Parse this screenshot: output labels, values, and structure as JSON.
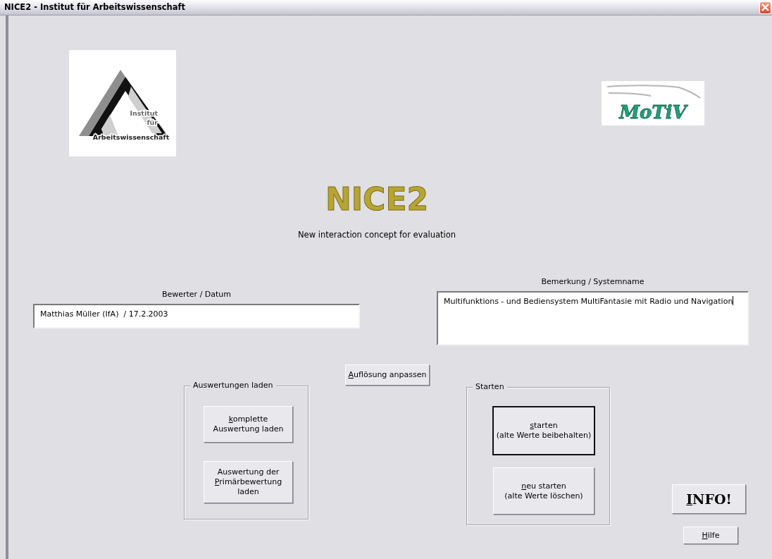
{
  "window": {
    "title": "NICE2 - Institut für Arbeitswissenschaft"
  },
  "logos": [
    {
      "kind": "institute",
      "lines": [
        "Institut",
        "für",
        "Arbeitswissenschaft"
      ]
    },
    {
      "kind": "motiv",
      "lines": [
        "MoTiV"
      ]
    }
  ],
  "heading": "NICE2",
  "subtitle": "New interaction concept for evaluation",
  "fields": [
    {
      "kind": "single",
      "label": "Bewerter / Datum",
      "value": "Matthias Müller (IfA)  / 17.2.2003",
      "focused": false
    },
    {
      "kind": "multi",
      "label": "Bemerkung / Systemname",
      "value": "Multifunktions - und Bediensystem MultiFantasie mit Radio und Navigation",
      "focused": true
    }
  ],
  "resize_button": {
    "key": "A",
    "post": "uflösung anpassen",
    "default": false
  },
  "groups": [
    {
      "title": "Auswertungen laden",
      "buttons": [
        {
          "key": "k",
          "post": "omplette\nAuswertung laden",
          "default": false
        },
        {
          "pre": "Auswertung der\n",
          "key": "P",
          "post": "rimärbewertung\nladen",
          "default": false
        }
      ]
    },
    {
      "title": "Starten",
      "buttons": [
        {
          "key": "s",
          "post": "tarten\n(alte Werte beibehalten)",
          "default": true
        },
        {
          "key": "n",
          "post": "eu starten\n(alte Werte löschen)",
          "default": false
        }
      ]
    }
  ],
  "info_button": {
    "key": "I",
    "post": "NFO!",
    "default": false
  },
  "help_button": {
    "key": "H",
    "post": "ilfe",
    "default": false
  }
}
